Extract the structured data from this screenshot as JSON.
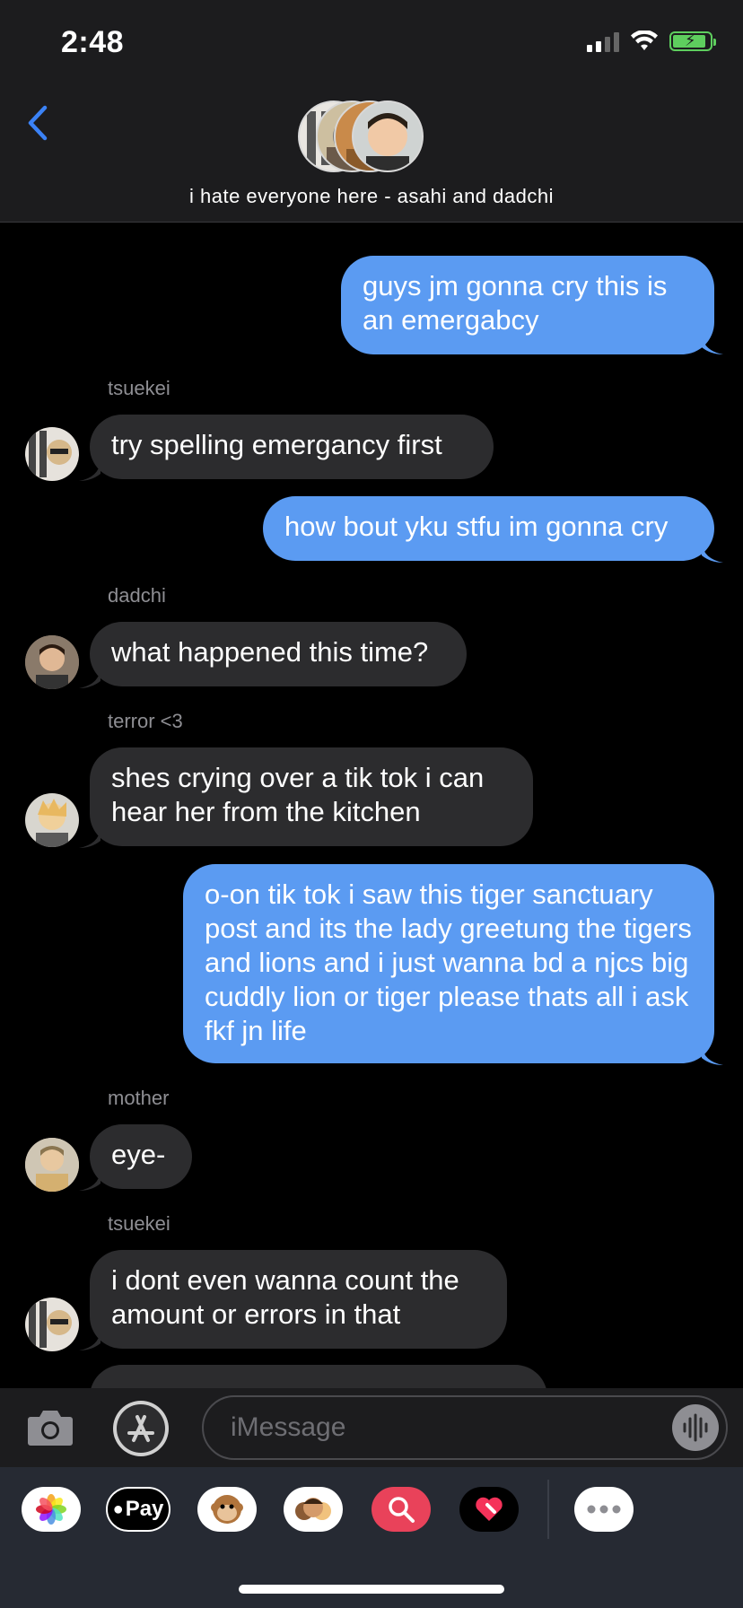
{
  "status_bar": {
    "time": "2:48"
  },
  "header": {
    "group_name": "i hate everyone here - asahi and dadchi"
  },
  "messages": [
    {
      "side": "out",
      "text": "guys jm gonna cry this is an emergabcy"
    },
    {
      "side": "in",
      "sender": "tsuekei",
      "text": "try spelling emergancy first"
    },
    {
      "side": "out",
      "text": "how bout yku stfu im gonna cry"
    },
    {
      "side": "in",
      "sender": "dadchi",
      "text": "what happened this time?"
    },
    {
      "side": "in",
      "sender": "terror <3",
      "text": "shes crying over a tik tok i can hear her from the kitchen"
    },
    {
      "side": "out",
      "text": "o-on tik tok i saw this tiger sanctuary post and its the lady greetung the tigers and lions and i just wanna bd a njcs big cuddly lion or tiger please thats all i ask fkf jn life"
    },
    {
      "side": "in",
      "sender": "mother",
      "text": "eye-"
    },
    {
      "side": "in",
      "sender": "tsuekei",
      "text": "i dont even wanna count the amount or errors in that"
    }
  ],
  "input": {
    "placeholder": "iMessage"
  },
  "app_tray": {
    "items": [
      {
        "name": "photos-app",
        "label": ""
      },
      {
        "name": "apple-pay",
        "label": "Pay"
      },
      {
        "name": "animoji",
        "label": ""
      },
      {
        "name": "memoji",
        "label": ""
      },
      {
        "name": "image-search",
        "label": ""
      },
      {
        "name": "digital-touch",
        "label": ""
      },
      {
        "name": "more",
        "label": ""
      }
    ]
  },
  "colors": {
    "outgoing": "#5b9bf2",
    "incoming": "#2c2c2e",
    "accent": "#3b82f6",
    "battery": "#5ece5e"
  }
}
